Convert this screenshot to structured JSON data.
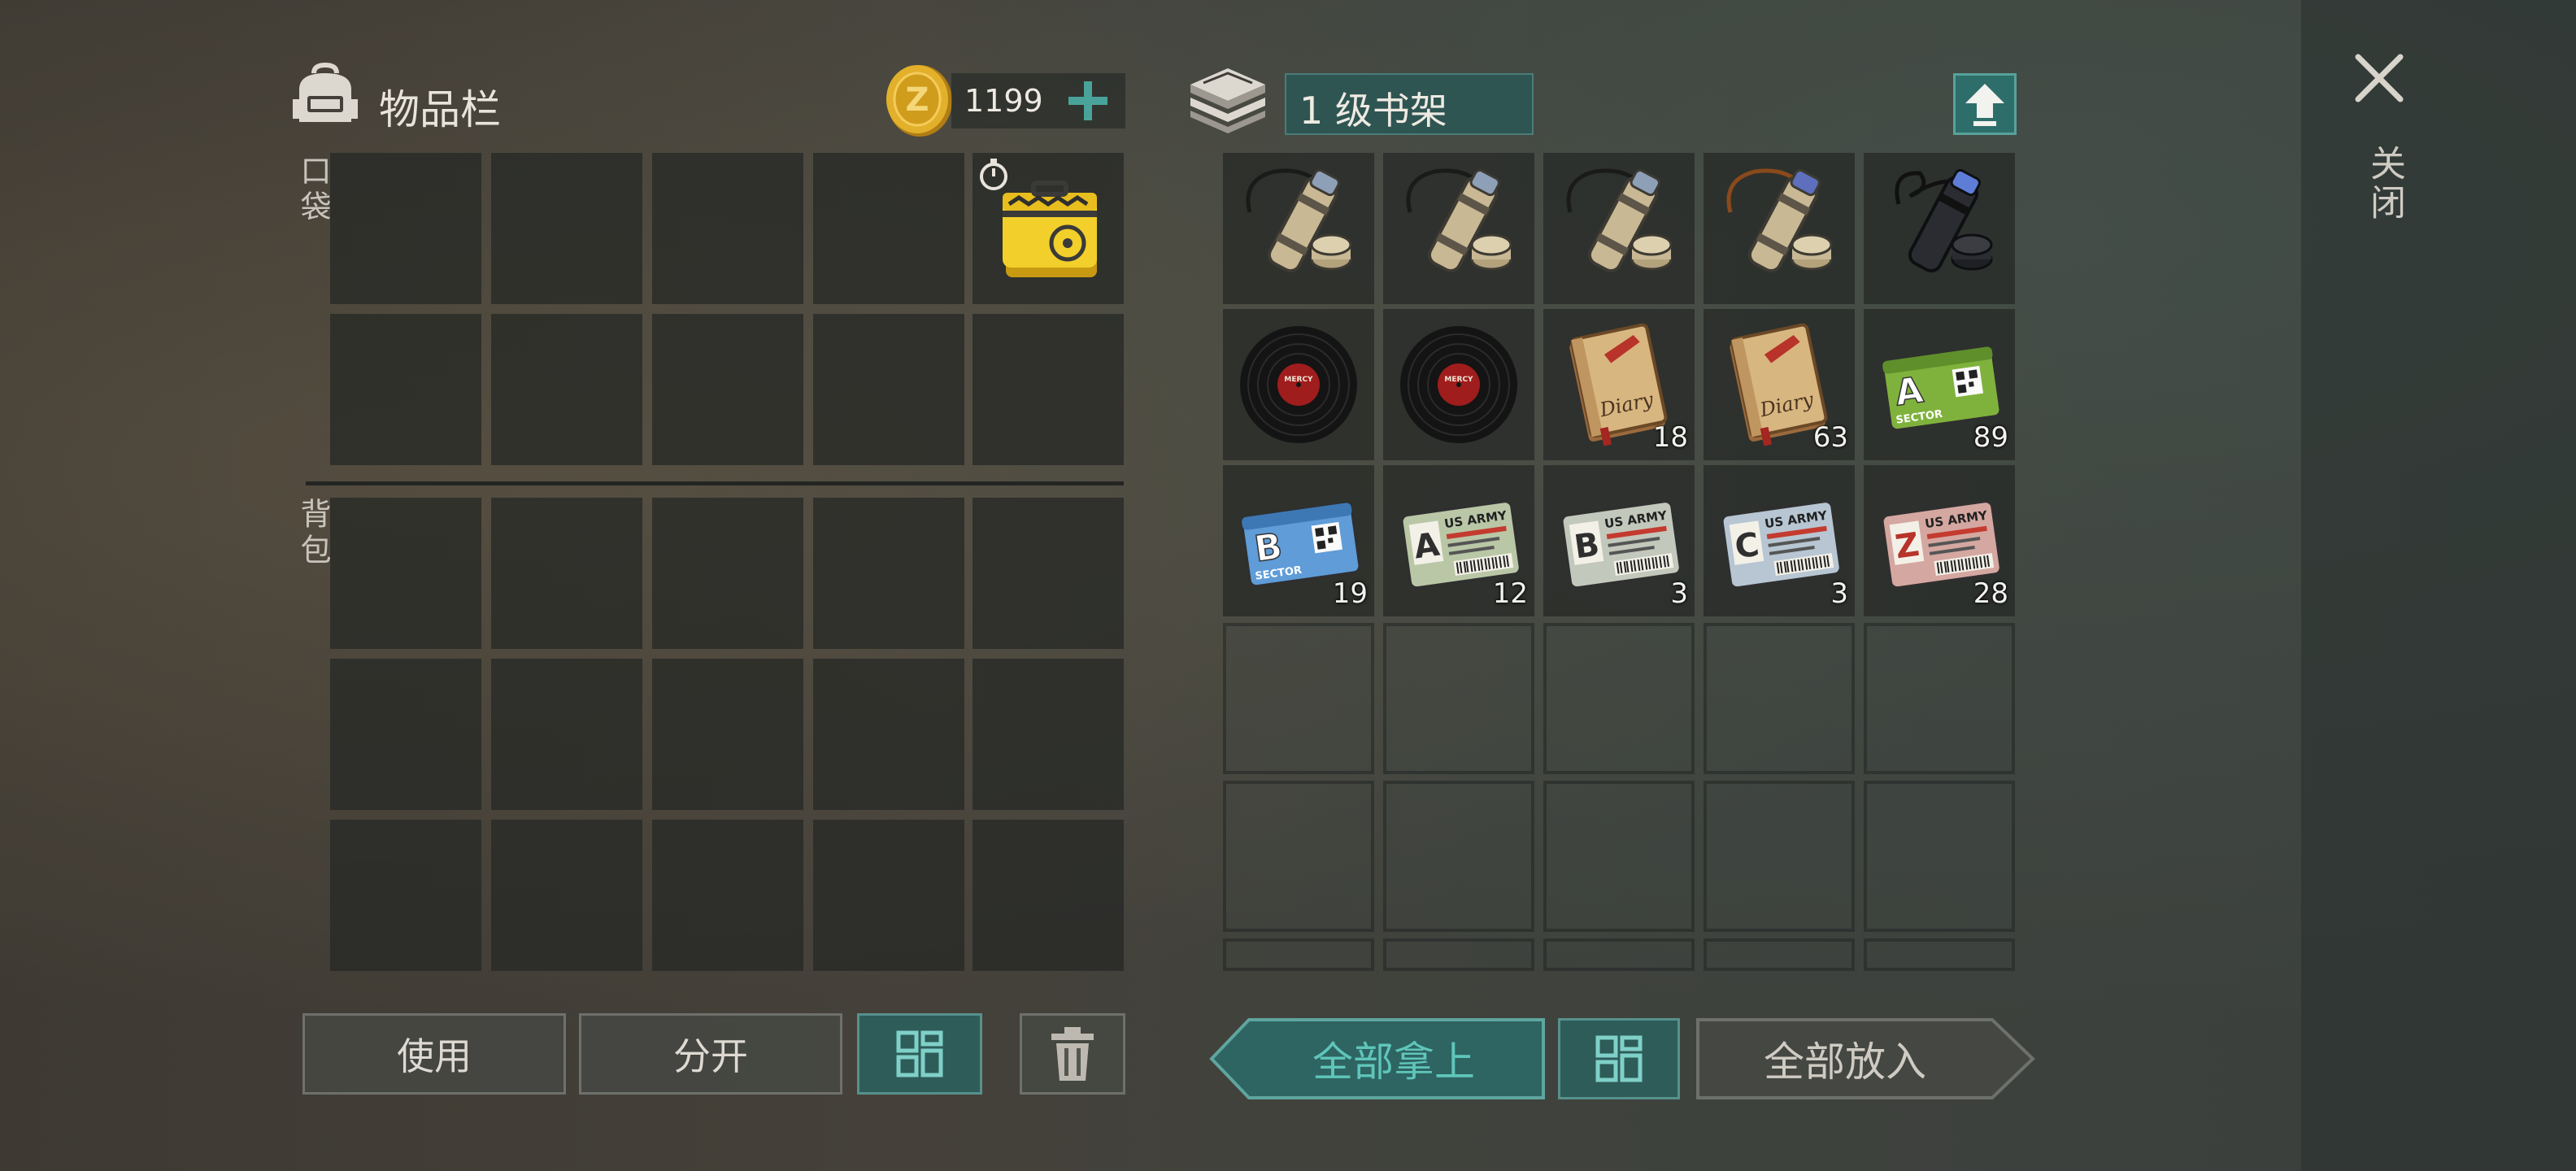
{
  "inventory": {
    "title": "物品栏",
    "coins": "1199",
    "pocket_label": "口袋",
    "backpack_label": "背包"
  },
  "storage": {
    "title": "1 级书架",
    "slots": [
      {
        "item": "map-case",
        "qty": ""
      },
      {
        "item": "map-case",
        "qty": ""
      },
      {
        "item": "map-case",
        "qty": ""
      },
      {
        "item": "map-case-orange",
        "qty": ""
      },
      {
        "item": "map-case-black",
        "qty": ""
      },
      {
        "item": "vinyl-record",
        "qty": ""
      },
      {
        "item": "vinyl-record",
        "qty": ""
      },
      {
        "item": "diary",
        "qty": "18"
      },
      {
        "item": "diary",
        "qty": "63"
      },
      {
        "item": "sector-card-a",
        "qty": "89"
      },
      {
        "item": "sector-card-b",
        "qty": "19"
      },
      {
        "item": "army-card-a",
        "qty": "12"
      },
      {
        "item": "army-card-b",
        "qty": "3"
      },
      {
        "item": "army-card-c",
        "qty": "3"
      },
      {
        "item": "army-card-z",
        "qty": "28"
      }
    ]
  },
  "item_text": {
    "diary": "Diary",
    "sector": "SECTOR",
    "army": "US ARMY",
    "card_a": "A",
    "card_b": "B",
    "card_c": "C",
    "card_z": "Z",
    "record": "MERCY"
  },
  "buttons": {
    "use": "使用",
    "split": "分开",
    "take_all": "全部拿上",
    "put_all": "全部放入",
    "close": "关闭"
  },
  "colors": {
    "accent_teal": "#2e5c59",
    "accent_teal_border": "#57918c",
    "coin_gold": "#d9a521"
  },
  "icons": [
    "backpack-icon",
    "coin-icon",
    "plus-icon",
    "bookshelf-icon",
    "upgrade-arrow-icon",
    "sort-grid-icon",
    "trash-icon",
    "close-icon",
    "toolbox-icon",
    "timer-icon"
  ]
}
